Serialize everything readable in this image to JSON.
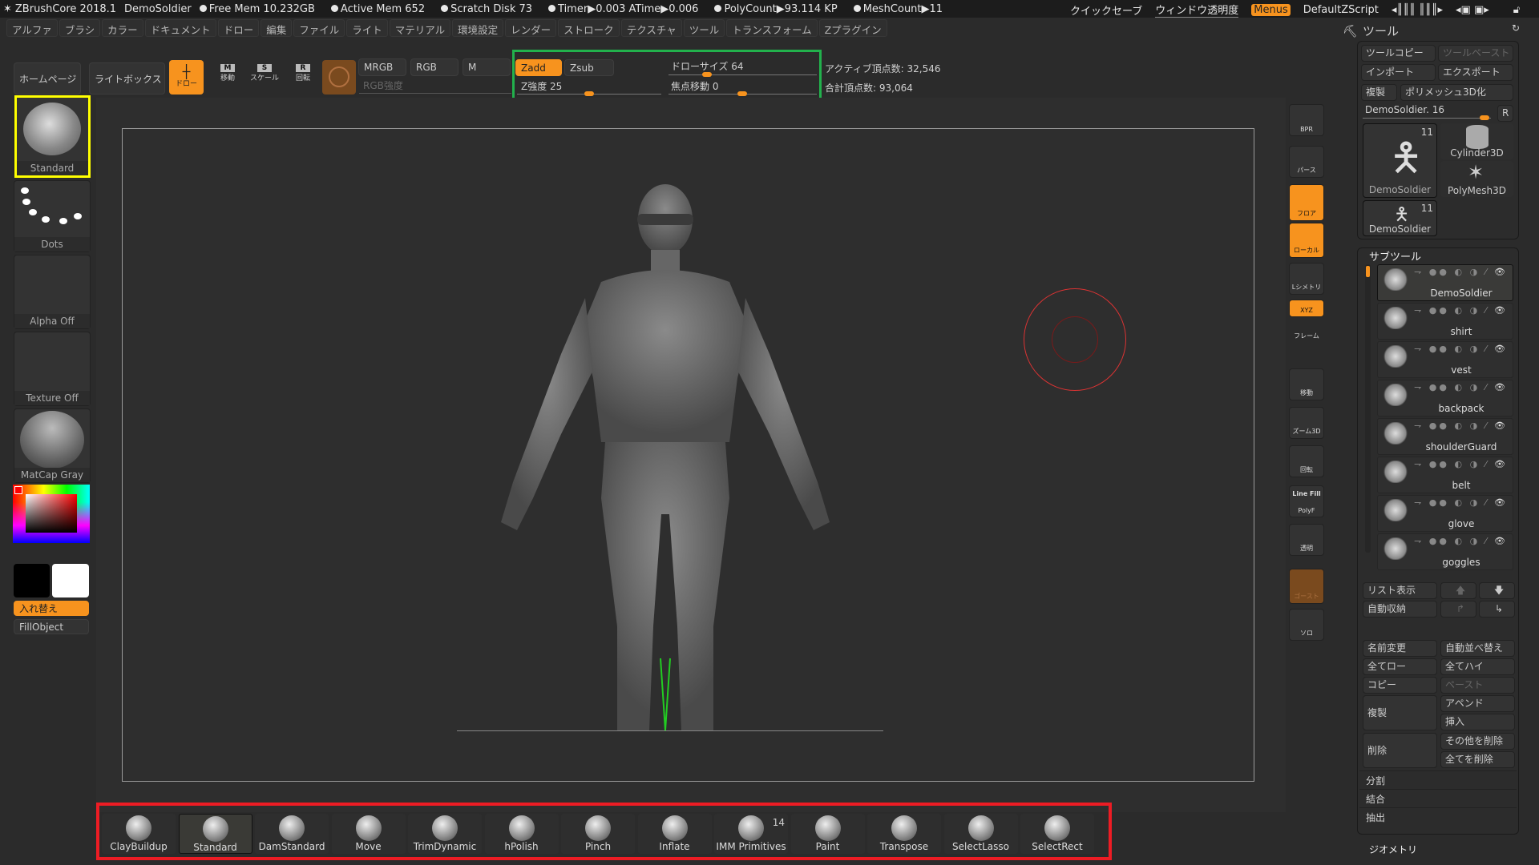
{
  "titlebar": {
    "app": "ZBrushCore 2018.1",
    "document": "DemoSoldier",
    "free_mem": "Free Mem 10.232GB",
    "active_mem": "Active Mem 652",
    "scratch_disk": "Scratch Disk 73",
    "timer": "Timer▶0.003 ATime▶0.006",
    "polycount": "PolyCount▶93.114 KP",
    "meshcount": "MeshCount▶11",
    "quicksave": "クイックセーブ",
    "window_transparency": "ウィンドウ透明度",
    "menus": "Menus",
    "script": "DefaultZScript"
  },
  "menubar": [
    "アルファ",
    "ブラシ",
    "カラー",
    "ドキュメント",
    "ドロー",
    "編集",
    "ファイル",
    "ライト",
    "マテリアル",
    "環境設定",
    "レンダー",
    "ストローク",
    "テクスチャ",
    "ツール",
    "トランスフォーム",
    "Zプラグイン"
  ],
  "toolbar": {
    "home": "ホームページ",
    "lightbox": "ライトボックス",
    "draw": "ドロー",
    "move": "移動",
    "scale": "スケール",
    "rotate": "回転",
    "mrgb": "MRGB",
    "rgb": "RGB",
    "m": "M",
    "rgb_intensity": "RGB強度",
    "zadd": "Zadd",
    "zsub": "Zsub",
    "z_intensity": "Z強度 25",
    "z_intensity_value": 25,
    "draw_size": "ドローサイズ 64",
    "draw_size_value": 64,
    "focal_shift": "焦点移動 0",
    "focal_shift_value": 0,
    "active_points": "アクティブ頂点数: 32,546",
    "total_points": "合計頂点数: 93,064"
  },
  "left": {
    "brush": "Standard",
    "stroke": "Dots",
    "alpha": "Alpha Off",
    "texture": "Texture Off",
    "material": "MatCap Gray",
    "swap": "入れ替え",
    "fill": "FillObject",
    "primary_color": "#000000",
    "secondary_color": "#ffffff"
  },
  "rightbar": [
    "BPR",
    "パース",
    "フロア",
    "ローカル",
    "Lシメトリ",
    "XYZ",
    "フレーム",
    "移動",
    "ズーム3D",
    "回転",
    "PolyF",
    "透明",
    "ゴースト",
    "ソロ"
  ],
  "rightbar_linefill": "Line Fill",
  "tool": {
    "title": "ツール",
    "copy": "ツールコピー",
    "paste": "ツールペースト",
    "import": "インポート",
    "export": "エクスポート",
    "clone": "複製",
    "polymesh": "ポリメッシュ3D化",
    "current": "DemoSoldier. 16",
    "r": "R",
    "items": [
      {
        "name": "DemoSoldier",
        "count": "11"
      },
      {
        "name": "Cylinder3D"
      },
      {
        "name": "PolyMesh3D"
      },
      {
        "name": "DemoSoldier",
        "count": "11"
      }
    ]
  },
  "subtool": {
    "title": "サブツール",
    "items": [
      "DemoSoldier",
      "shirt",
      "vest",
      "backpack",
      "shoulderGuard",
      "belt",
      "glove",
      "goggles"
    ],
    "list": "リスト表示",
    "autocollapse": "自動収納",
    "rename": "名前変更",
    "autosort": "自動並べ替え",
    "all_low": "全てロー",
    "all_high": "全てハイ",
    "copy": "コピー",
    "paste": "ペースト",
    "duplicate": "複製",
    "append": "アペンド",
    "insert": "挿入",
    "delete": "削除",
    "del_other": "その他を削除",
    "del_all": "全てを削除",
    "split": "分割",
    "merge": "結合",
    "extract": "抽出",
    "geometry": "ジオメトリ"
  },
  "brushes": [
    {
      "name": "ClayBuildup"
    },
    {
      "name": "Standard"
    },
    {
      "name": "DamStandard"
    },
    {
      "name": "Move"
    },
    {
      "name": "TrimDynamic"
    },
    {
      "name": "hPolish"
    },
    {
      "name": "Pinch"
    },
    {
      "name": "Inflate"
    },
    {
      "name": "IMM Primitives",
      "count": "14"
    },
    {
      "name": "Paint"
    },
    {
      "name": "Transpose"
    },
    {
      "name": "SelectLasso"
    },
    {
      "name": "SelectRect"
    }
  ],
  "colors": {
    "accent": "#f7931e",
    "green_box": "#22b14c",
    "yellow_box": "#ffff00",
    "red_box": "#ed1c24"
  }
}
